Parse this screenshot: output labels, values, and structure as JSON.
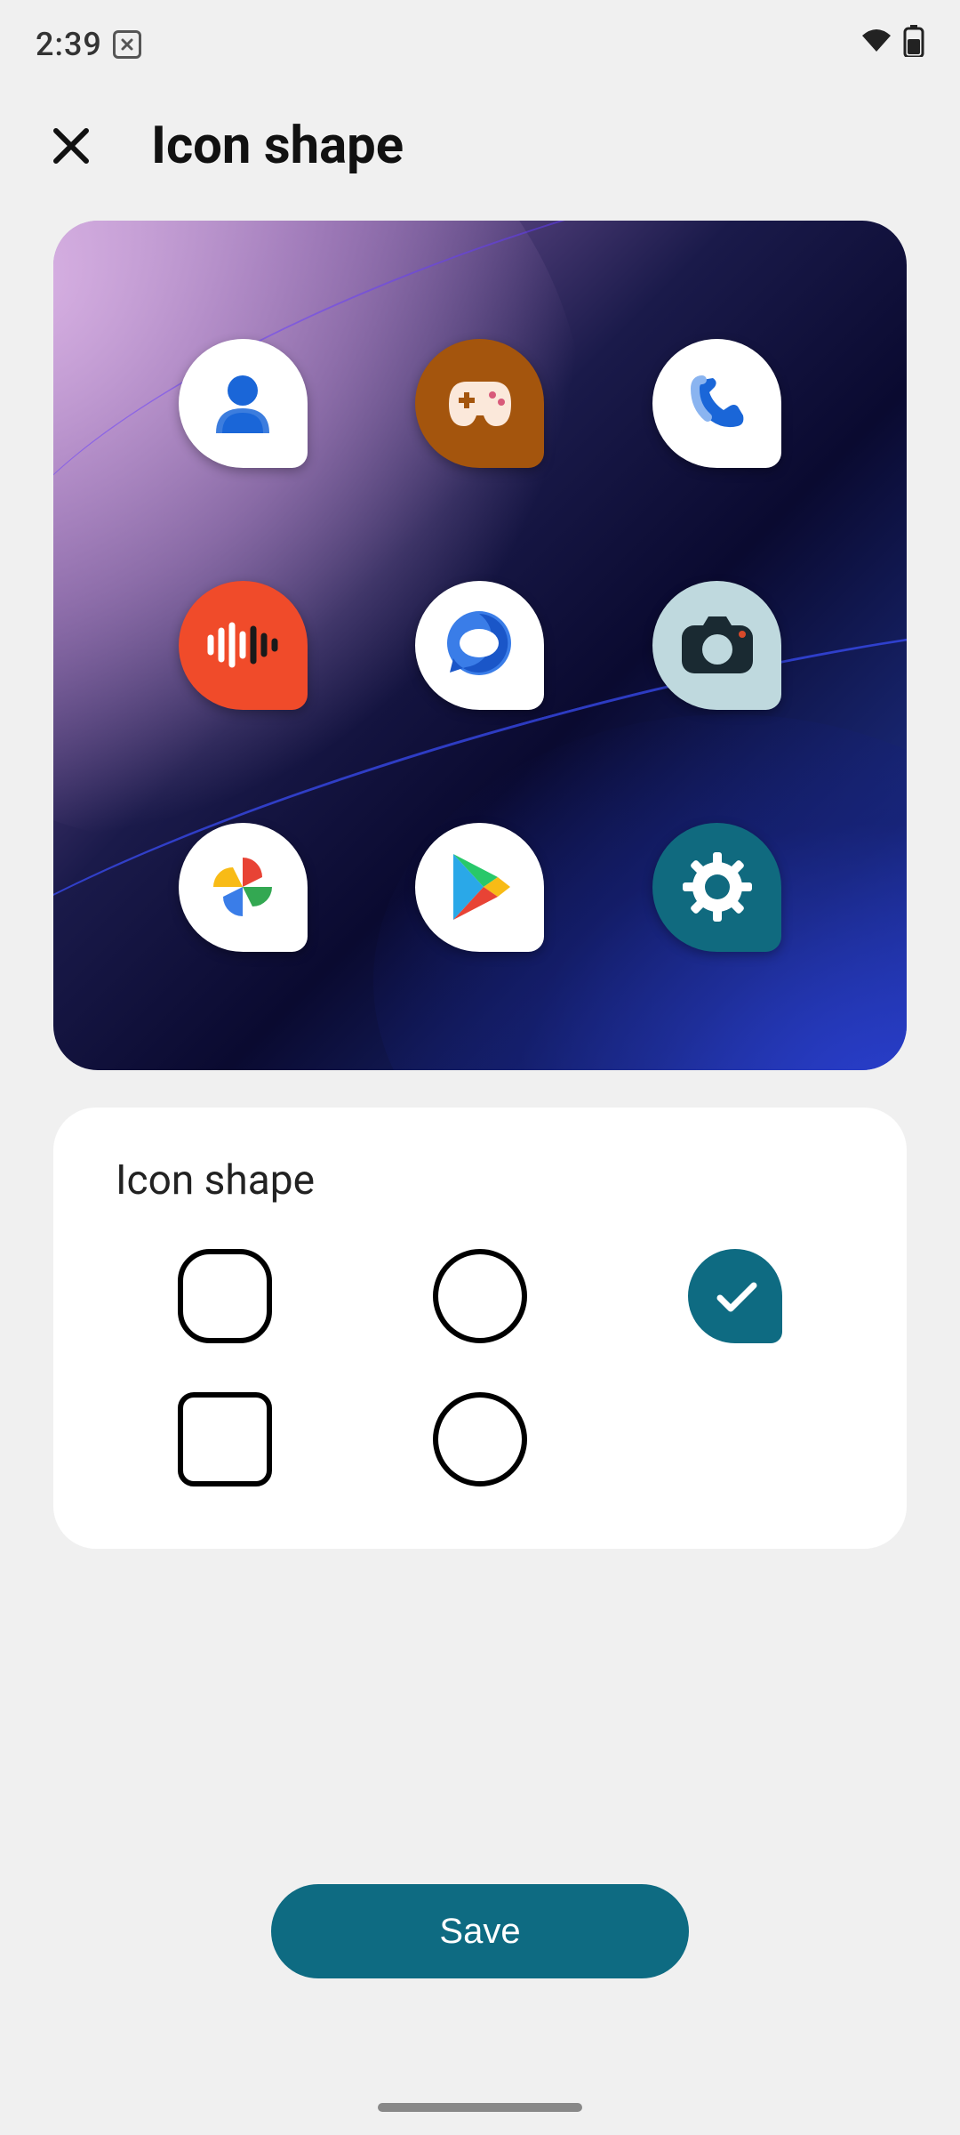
{
  "status": {
    "time": "2:39",
    "box_indicator": "x"
  },
  "header": {
    "title": "Icon shape"
  },
  "preview": {
    "icons": [
      {
        "name": "contacts",
        "bg": "#ffffff"
      },
      {
        "name": "games",
        "bg": "#a4550d"
      },
      {
        "name": "phone",
        "bg": "#ffffff"
      },
      {
        "name": "recorder",
        "bg": "#f04b2a"
      },
      {
        "name": "messages",
        "bg": "#ffffff"
      },
      {
        "name": "camera",
        "bg": "#bfd9de"
      },
      {
        "name": "photos",
        "bg": "#ffffff"
      },
      {
        "name": "play-store",
        "bg": "#ffffff"
      },
      {
        "name": "settings",
        "bg": "#106a7f"
      }
    ]
  },
  "options": {
    "title": "Icon shape",
    "shapes": [
      {
        "id": "squircle",
        "selected": false
      },
      {
        "id": "circle",
        "selected": false
      },
      {
        "id": "teardrop",
        "selected": true
      },
      {
        "id": "rounded-square",
        "selected": false
      },
      {
        "id": "circle-alt",
        "selected": false
      }
    ]
  },
  "actions": {
    "save_label": "Save"
  },
  "colors": {
    "accent": "#0e6b82"
  }
}
